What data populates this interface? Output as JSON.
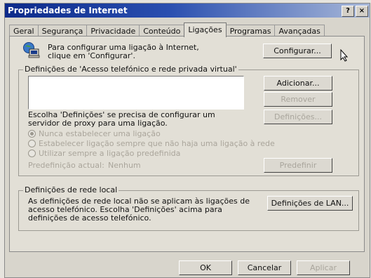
{
  "window": {
    "title": "Propriedades de Internet"
  },
  "title_buttons": {
    "help": "?",
    "close": "×"
  },
  "tabs": [
    {
      "label": "Geral"
    },
    {
      "label": "Segurança"
    },
    {
      "label": "Privacidade"
    },
    {
      "label": "Conteúdo"
    },
    {
      "label": "Ligações"
    },
    {
      "label": "Programas"
    },
    {
      "label": "Avançadas"
    }
  ],
  "active_tab": "Ligações",
  "setup": {
    "text": "Para configurar uma ligação à Internet, clique em 'Configurar'.",
    "button": "Configurar..."
  },
  "dialup": {
    "legend": "Definições de 'Acesso telefónico e rede privada virtual'",
    "add_button": "Adicionar...",
    "remove_button": "Remover",
    "settings_button": "Definições...",
    "proxy_text": "Escolha 'Definições' se precisa de configurar um servidor de proxy para uma ligação.",
    "radio_options": [
      "Nunca estabelecer uma ligação",
      "Estabelecer ligação sempre que não haja uma ligação à rede",
      "Utilizar sempre a ligação predefinida"
    ],
    "default_label": "Predefinição actual:",
    "default_value": "Nenhum",
    "set_default_button": "Predefinir"
  },
  "lan": {
    "legend": "Definições de rede local",
    "text": "As definições de rede local não se aplicam às ligações de acesso telefónico. Escolha 'Definições' acima para definições de acesso telefónico.",
    "button": "Definições de LAN..."
  },
  "footer": {
    "ok": "OK",
    "cancel": "Cancelar",
    "apply": "Aplicar"
  }
}
